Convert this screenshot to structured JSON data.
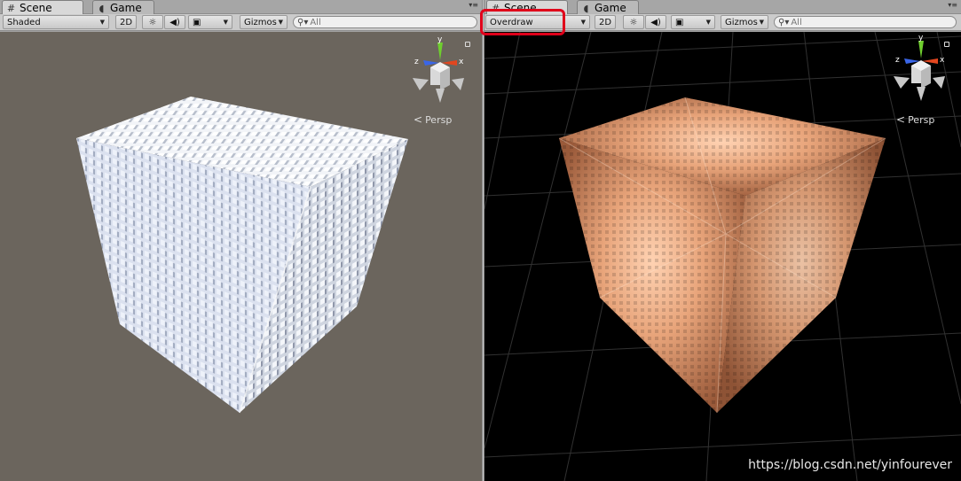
{
  "left_view": {
    "tabs": [
      {
        "label": "Scene",
        "icon": "hash-icon",
        "active": true
      },
      {
        "label": "Game",
        "icon": "pacman-icon",
        "active": false
      }
    ],
    "draw_mode": "Shaded",
    "mode_2d_label": "2D",
    "gizmos_label": "Gizmos",
    "search_placeholder": "All",
    "gizmo_axes": {
      "y": "y",
      "x": "x",
      "z": "z"
    },
    "projection_label": "Persp"
  },
  "right_view": {
    "tabs": [
      {
        "label": "Scene",
        "icon": "hash-icon",
        "active": true
      },
      {
        "label": "Game",
        "icon": "pacman-icon",
        "active": false
      }
    ],
    "draw_mode": "Overdraw",
    "mode_2d_label": "2D",
    "gizmos_label": "Gizmos",
    "search_placeholder": "All",
    "gizmo_axes": {
      "y": "y",
      "x": "x",
      "z": "z"
    },
    "projection_label": "Persp"
  },
  "watermark": "https://blog.csdn.net/yinfourever",
  "colors": {
    "highlight": "#e0001a",
    "shaded_background": "#6b655d",
    "overdraw_background": "#000000",
    "overdraw_tint": "#e8a47a"
  }
}
